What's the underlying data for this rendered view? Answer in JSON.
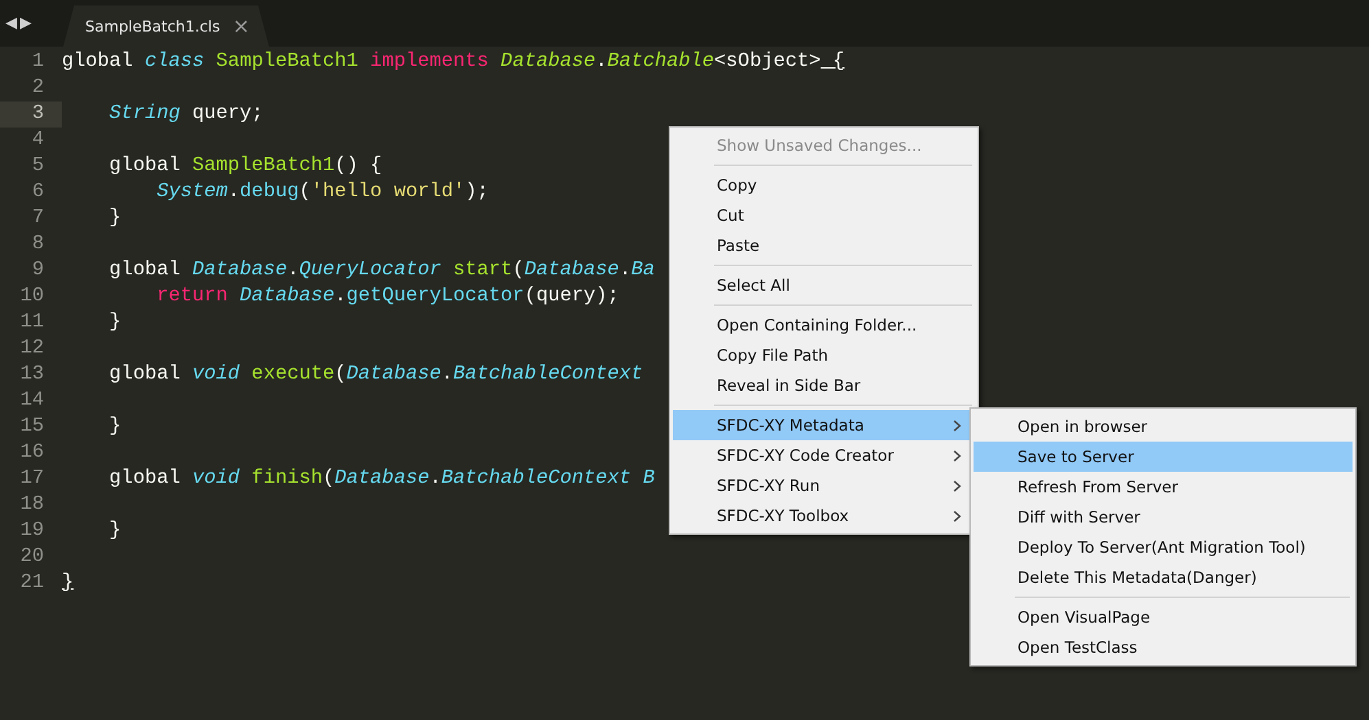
{
  "tab_bar": {
    "nav": [
      "◀",
      "▶"
    ],
    "tabs": [
      {
        "label": "SampleBatch1.cls",
        "close": "×",
        "selected": true
      }
    ]
  },
  "editor": {
    "lines": [
      {
        "number": "1",
        "current": false,
        "tokens": [
          {
            "kind": "plain",
            "text": "global"
          },
          {
            "kind": "storage",
            "text": " class"
          },
          {
            "kind": "entity",
            "text": " SampleBatch1"
          },
          {
            "kind": "keyword",
            "text": " implements"
          },
          {
            "kind": "type",
            "text": " Database"
          },
          {
            "kind": "plain",
            "text": "."
          },
          {
            "kind": "type",
            "text": "Batchable"
          },
          {
            "kind": "plain",
            "text": "<sObject>"
          },
          {
            "kind": "match",
            "text": " {"
          }
        ]
      },
      {
        "number": "2",
        "current": false
      },
      {
        "number": "3",
        "current": true,
        "tokens": [
          {
            "kind": "storage",
            "text": "    String"
          },
          {
            "kind": "plain",
            "text": " query;"
          }
        ]
      },
      {
        "number": "4",
        "current": false
      },
      {
        "number": "5",
        "current": false,
        "tokens": [
          {
            "kind": "plain",
            "text": "    global"
          },
          {
            "kind": "entity",
            "text": " SampleBatch1"
          },
          {
            "kind": "plain",
            "text": "() {"
          }
        ]
      },
      {
        "number": "6",
        "current": false,
        "tokens": [
          {
            "kind": "storage",
            "text": "        System"
          },
          {
            "kind": "plain",
            "text": "."
          },
          {
            "kind": "func",
            "text": "debug"
          },
          {
            "kind": "plain",
            "text": "("
          },
          {
            "kind": "string",
            "text": "'hello world'"
          },
          {
            "kind": "plain",
            "text": ");"
          }
        ]
      },
      {
        "number": "7",
        "current": false,
        "tokens": [
          {
            "kind": "plain",
            "text": "    }"
          }
        ]
      },
      {
        "number": "8",
        "current": false
      },
      {
        "number": "9",
        "current": false,
        "tokens": [
          {
            "kind": "plain",
            "text": "    global"
          },
          {
            "kind": "storage",
            "text": " Database"
          },
          {
            "kind": "plain",
            "text": "."
          },
          {
            "kind": "storage",
            "text": "QueryLocator"
          },
          {
            "kind": "entity",
            "text": " start"
          },
          {
            "kind": "plain",
            "text": "("
          },
          {
            "kind": "storage",
            "text": "Database"
          },
          {
            "kind": "plain",
            "text": "."
          },
          {
            "kind": "storage",
            "text": "Ba"
          }
        ]
      },
      {
        "number": "10",
        "current": false,
        "tokens": [
          {
            "kind": "keyword",
            "text": "        return"
          },
          {
            "kind": "storage",
            "text": " Database"
          },
          {
            "kind": "plain",
            "text": "."
          },
          {
            "kind": "func",
            "text": "getQueryLocator"
          },
          {
            "kind": "plain",
            "text": "(query);"
          }
        ]
      },
      {
        "number": "11",
        "current": false,
        "tokens": [
          {
            "kind": "plain",
            "text": "    }"
          }
        ]
      },
      {
        "number": "12",
        "current": false
      },
      {
        "number": "13",
        "current": false,
        "tokens": [
          {
            "kind": "plain",
            "text": "    global"
          },
          {
            "kind": "storage",
            "text": " void"
          },
          {
            "kind": "entity",
            "text": " execute"
          },
          {
            "kind": "plain",
            "text": "("
          },
          {
            "kind": "storage",
            "text": "Database"
          },
          {
            "kind": "plain",
            "text": "."
          },
          {
            "kind": "storage",
            "text": "BatchableContext"
          }
        ]
      },
      {
        "number": "14",
        "current": false
      },
      {
        "number": "15",
        "current": false,
        "tokens": [
          {
            "kind": "plain",
            "text": "    }"
          }
        ]
      },
      {
        "number": "16",
        "current": false
      },
      {
        "number": "17",
        "current": false,
        "tokens": [
          {
            "kind": "plain",
            "text": "    global"
          },
          {
            "kind": "storage",
            "text": " void"
          },
          {
            "kind": "entity",
            "text": " finish"
          },
          {
            "kind": "plain",
            "text": "("
          },
          {
            "kind": "storage",
            "text": "Database"
          },
          {
            "kind": "plain",
            "text": "."
          },
          {
            "kind": "storage",
            "text": "BatchableContext"
          },
          {
            "kind": "storage",
            "text": " B"
          }
        ]
      },
      {
        "number": "18",
        "current": false
      },
      {
        "number": "19",
        "current": false,
        "tokens": [
          {
            "kind": "plain",
            "text": "    }"
          }
        ]
      },
      {
        "number": "20",
        "current": false
      },
      {
        "number": "21",
        "current": false,
        "tokens": [
          {
            "kind": "match",
            "text": "}"
          }
        ]
      }
    ]
  },
  "context_menu": {
    "items": [
      {
        "kind": "item",
        "label": "Show Unsaved Changes...",
        "disabled": true,
        "selected": false
      },
      {
        "kind": "separator"
      },
      {
        "kind": "item",
        "label": "Copy",
        "disabled": false,
        "selected": false
      },
      {
        "kind": "item",
        "label": "Cut",
        "disabled": false,
        "selected": false
      },
      {
        "kind": "item",
        "label": "Paste",
        "disabled": false,
        "selected": false
      },
      {
        "kind": "separator"
      },
      {
        "kind": "item",
        "label": "Select All",
        "disabled": false,
        "selected": false
      },
      {
        "kind": "separator"
      },
      {
        "kind": "item",
        "label": "Open Containing Folder...",
        "disabled": false,
        "selected": false
      },
      {
        "kind": "item",
        "label": "Copy File Path",
        "disabled": false,
        "selected": false
      },
      {
        "kind": "item",
        "label": "Reveal in Side Bar",
        "disabled": false,
        "selected": false
      },
      {
        "kind": "separator"
      },
      {
        "kind": "submenu",
        "label": "SFDC-XY Metadata",
        "disabled": false,
        "selected": true
      },
      {
        "kind": "submenu",
        "label": "SFDC-XY Code Creator",
        "disabled": false,
        "selected": false
      },
      {
        "kind": "submenu",
        "label": "SFDC-XY Run",
        "disabled": false,
        "selected": false
      },
      {
        "kind": "submenu",
        "label": "SFDC-XY Toolbox",
        "disabled": false,
        "selected": false
      }
    ]
  },
  "submenu": {
    "items": [
      {
        "kind": "item",
        "label": "Open in browser",
        "disabled": false,
        "selected": false
      },
      {
        "kind": "item",
        "label": "Save to Server",
        "disabled": false,
        "selected": true
      },
      {
        "kind": "item",
        "label": "Refresh From Server",
        "disabled": false,
        "selected": false
      },
      {
        "kind": "item",
        "label": "Diff with Server",
        "disabled": false,
        "selected": false
      },
      {
        "kind": "item",
        "label": "Deploy To Server(Ant Migration Tool)",
        "disabled": false,
        "selected": false
      },
      {
        "kind": "item",
        "label": "Delete This Metadata(Danger)",
        "disabled": false,
        "selected": false
      },
      {
        "kind": "separator"
      },
      {
        "kind": "item",
        "label": "Open VisualPage",
        "disabled": false,
        "selected": false
      },
      {
        "kind": "item",
        "label": "Open TestClass",
        "disabled": false,
        "selected": false
      }
    ]
  }
}
